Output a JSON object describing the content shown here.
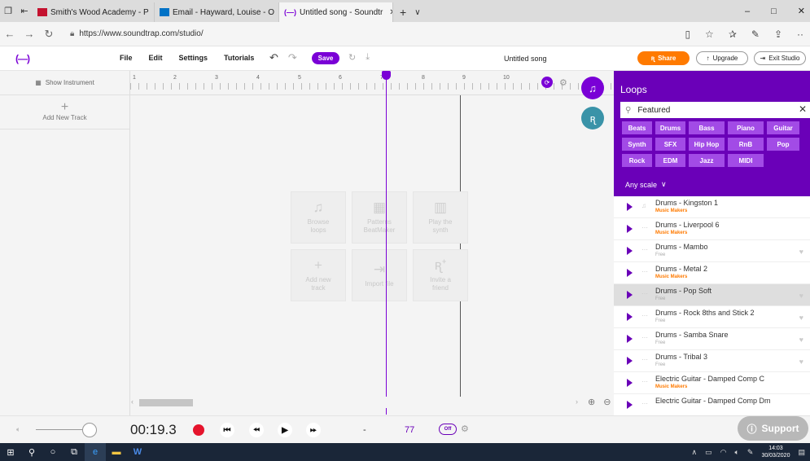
{
  "browser": {
    "tabs": [
      {
        "label": "Smith's Wood Academy - P",
        "favicon_color": "#c4122f"
      },
      {
        "label": "Email - Hayward, Louise - O",
        "favicon_color": "#0072c6"
      },
      {
        "label": "Untitled song - Soundtr",
        "favicon_color": "#7a00d6",
        "close": "✕"
      }
    ],
    "new_tab": "+",
    "tab_menu": "∨",
    "url": "https://www.soundtrap.com/studio/",
    "window_controls": {
      "minimize": "–",
      "maximize": "□",
      "close": "✕"
    }
  },
  "app": {
    "logo": "(—)",
    "menu": [
      "File",
      "Edit",
      "Settings",
      "Tutorials"
    ],
    "save_label": "Save",
    "song_title": "Untitled song",
    "share_label": "Share",
    "upgrade_label": "Upgrade",
    "exit_label": "Exit Studio",
    "accent": "#7a00d6",
    "share_color": "#ff7a00"
  },
  "tracks": {
    "show_instrument": "Show Instrument",
    "add_new_track": "Add New Track"
  },
  "ruler": {
    "numbers": [
      "1",
      "2",
      "3",
      "4",
      "5",
      "6",
      "7",
      "8",
      "9",
      "10"
    ]
  },
  "quick_actions": [
    {
      "icon": "music-note-icon",
      "glyph": "♫",
      "line1": "Browse",
      "line2": "loops"
    },
    {
      "icon": "beatmaker-grid-icon",
      "glyph": "▦",
      "line1": "Patterns",
      "line2": "BeatMaker"
    },
    {
      "icon": "piano-icon",
      "glyph": "▥",
      "line1": "Play the",
      "line2": "synth"
    },
    {
      "icon": "plus-icon",
      "glyph": "+",
      "line1": "Add new",
      "line2": "track"
    },
    {
      "icon": "import-icon",
      "glyph": "⇥",
      "line1": "Import file",
      "line2": ""
    },
    {
      "icon": "invite-friend-icon",
      "glyph": "ꭆ⁺",
      "line1": "Invite a",
      "line2": "friend"
    }
  ],
  "loops": {
    "title": "Loops",
    "search_value": "Featured",
    "categories": [
      "Beats",
      "Drums",
      "Bass",
      "Piano",
      "Guitar",
      "Synth",
      "SFX",
      "Hip Hop",
      "RnB",
      "Pop",
      "Rock",
      "EDM",
      "Jazz",
      "MIDI"
    ],
    "scale_label": "Any scale",
    "items": [
      {
        "name": "Drums - Kingston 1",
        "source": "Music Makers",
        "type": "mm"
      },
      {
        "name": "Drums - Liverpool 6",
        "source": "Music Makers",
        "type": "mm"
      },
      {
        "name": "Drums - Mambo",
        "source": "Free",
        "type": "free"
      },
      {
        "name": "Drums - Metal 2",
        "source": "Music Makers",
        "type": "mm"
      },
      {
        "name": "Drums - Pop Soft",
        "source": "Free",
        "type": "free"
      },
      {
        "name": "Drums - Rock 8ths and Stick 2",
        "source": "Free",
        "type": "free"
      },
      {
        "name": "Drums - Samba Snare",
        "source": "Free",
        "type": "free"
      },
      {
        "name": "Drums - Tribal 3",
        "source": "Free",
        "type": "free"
      },
      {
        "name": "Electric Guitar - Damped Comp C",
        "source": "Music Makers",
        "type": "mm"
      },
      {
        "name": "Electric Guitar - Damped Comp Dm",
        "source": "",
        "type": "mm"
      }
    ]
  },
  "transport": {
    "time": "00:19.3",
    "key": "-",
    "tempo": "77",
    "metronome": "Off",
    "support_label": "Support"
  },
  "taskbar": {
    "time": "14:03",
    "date": "30/03/2020"
  }
}
